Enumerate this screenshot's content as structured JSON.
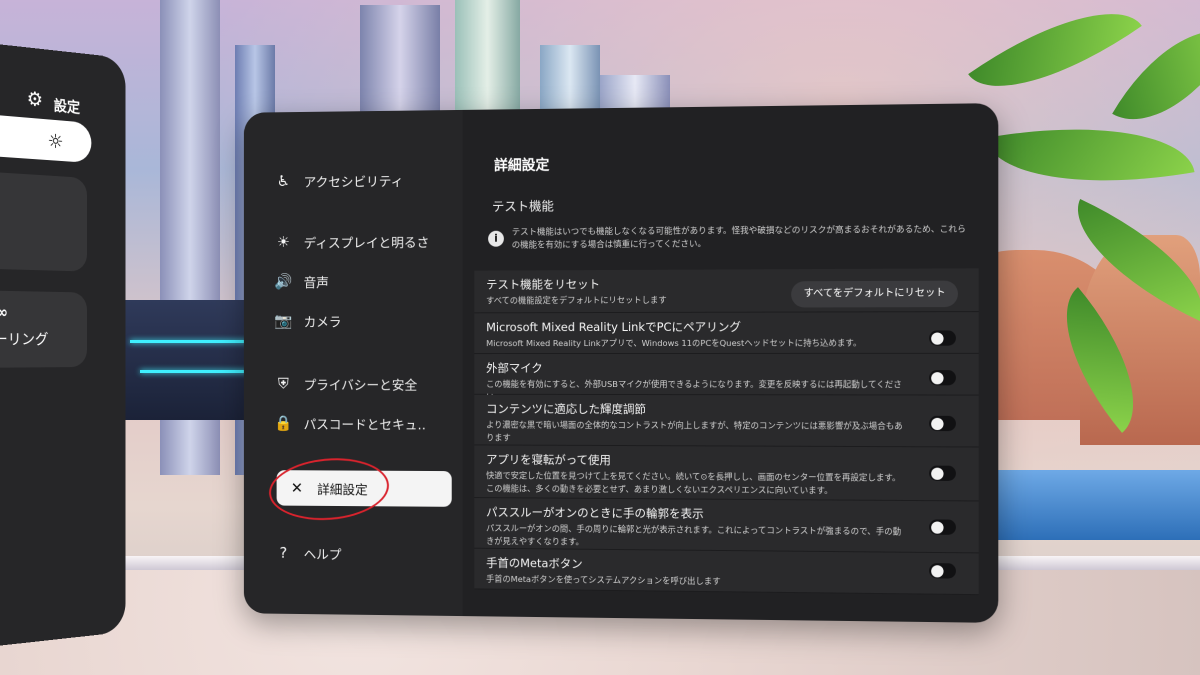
{
  "side_panel": {
    "title": "設定",
    "card_label": "ーリング"
  },
  "nav": {
    "items": [
      {
        "label": "アクセシビリティ",
        "icon": "accessibility-icon",
        "glyph": "♿"
      },
      {
        "label": "ディスプレイと明るさ",
        "icon": "brightness-icon",
        "glyph": "☀"
      },
      {
        "label": "音声",
        "icon": "speaker-icon",
        "glyph": "🔊"
      },
      {
        "label": "カメラ",
        "icon": "camera-icon",
        "glyph": "📷"
      },
      {
        "label": "プライバシーと安全",
        "icon": "shield-icon",
        "glyph": "⛨"
      },
      {
        "label": "パスコードとセキュ‥",
        "icon": "lock-icon",
        "glyph": "🔒"
      },
      {
        "label": "詳細設定",
        "icon": "advanced-icon",
        "glyph": "✕"
      },
      {
        "label": "ヘルプ",
        "icon": "help-icon",
        "glyph": "?"
      }
    ]
  },
  "content": {
    "page_title": "詳細設定",
    "section_title": "テスト機能",
    "info": "テスト機能はいつでも機能しなくなる可能性があります。怪我や破損などのリスクが高まるおそれがあるため、これらの機能を有効にする場合は慎重に行ってください。",
    "rows": [
      {
        "title": "テスト機能をリセット",
        "desc": "すべての機能設定をデフォルトにリセットします",
        "button": "すべてをデフォルトにリセット",
        "toggle": false
      },
      {
        "title": "Microsoft Mixed Reality LinkでPCにペアリング",
        "desc": "Microsoft Mixed Reality Linkアプリで、Windows 11のPCをQuestヘッドセットに持ち込めます。",
        "toggle": true,
        "on": false
      },
      {
        "title": "外部マイク",
        "desc": "この機能を有効にすると、外部USBマイクが使用できるようになります。変更を反映するには再起動してください。",
        "toggle": true,
        "on": false
      },
      {
        "title": "コンテンツに適応した輝度調節",
        "desc": "より濃密な黒で暗い場面の全体的なコントラストが向上しますが、特定のコンテンツには悪影響が及ぶ場合もあります",
        "toggle": true,
        "on": false
      },
      {
        "title": "アプリを寝転がって使用",
        "desc": "快適で安定した位置を見つけて上を見てください。続いて⊙を長押しし、画面のセンター位置を再設定します。この機能は、多くの動きを必要とせず、あまり激しくないエクスペリエンスに向いています。",
        "toggle": true,
        "on": false
      },
      {
        "title": "パススルーがオンのときに手の輪郭を表示",
        "desc": "パススルーがオンの間、手の周りに輪郭と光が表示されます。これによってコントラストが強まるので、手の動きが見えやすくなります。",
        "toggle": true,
        "on": false
      },
      {
        "title": "手首のMetaボタン",
        "desc": "手首のMetaボタンを使ってシステムアクションを呼び出します",
        "toggle": true,
        "on": false
      }
    ]
  },
  "colors": {
    "panel": "#212123",
    "nav": "#262628",
    "row": "#2a2a2c",
    "highlight": "#d9232d"
  }
}
